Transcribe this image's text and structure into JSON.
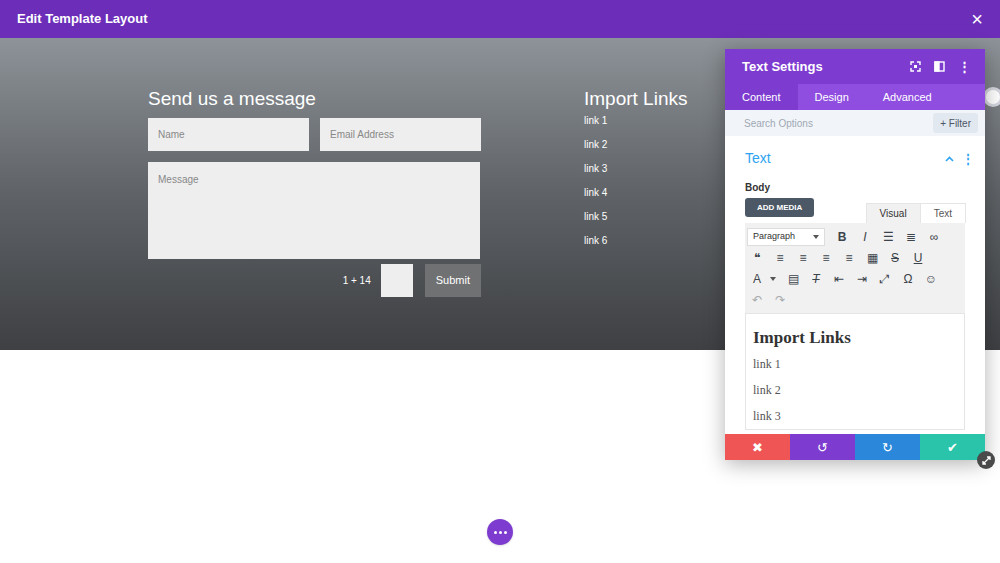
{
  "window": {
    "title": "Edit Template Layout",
    "close": "×"
  },
  "form": {
    "heading": "Send us a message",
    "fields": [
      {
        "placeholder": "Name"
      },
      {
        "placeholder": "Email Address"
      }
    ],
    "message": {
      "placeholder": "Message"
    },
    "captcha": "1 + 14",
    "submit": "Submit"
  },
  "links": {
    "heading": "Import Links",
    "items": [
      "link 1",
      "link 2",
      "link 3",
      "link 4",
      "link 5",
      "link 6"
    ]
  },
  "panel": {
    "title": "Text Settings",
    "menu": "⋮",
    "tabs": [
      {
        "label": "Content",
        "selected": true
      },
      {
        "label": "Design",
        "selected": false
      },
      {
        "label": "Advanced",
        "selected": false
      }
    ],
    "search": {
      "placeholder": "Search Options"
    },
    "filter": "+ Filter",
    "section": {
      "title": "Text",
      "expanded": true,
      "menu": "⋮"
    },
    "body_label": "Body",
    "add_media": "ADD MEDIA",
    "editor_tabs": [
      {
        "label": "Visual",
        "selected": true
      },
      {
        "label": "Text",
        "selected": false
      }
    ],
    "format": "Paragraph",
    "toolbar": [
      [
        "B",
        "I",
        "☰",
        "≣",
        "∞"
      ],
      [
        "❝",
        "≡",
        "≡",
        "≡",
        "≡",
        "▦",
        "S",
        "U"
      ],
      [
        "A",
        "▤",
        "T",
        "⇤",
        "⇥",
        "⤢",
        "Ω",
        "☺"
      ],
      [
        "↶",
        "↷"
      ]
    ],
    "content": {
      "heading": "Import Links",
      "lines": [
        "link 1",
        "link 2",
        "link 3"
      ]
    },
    "actions": [
      {
        "label": "✖",
        "color": "#ef5555"
      },
      {
        "label": "↺",
        "color": "#7e3bd0"
      },
      {
        "label": "↻",
        "color": "#2b87da"
      },
      {
        "label": "✔",
        "color": "#29c4a9"
      }
    ]
  }
}
